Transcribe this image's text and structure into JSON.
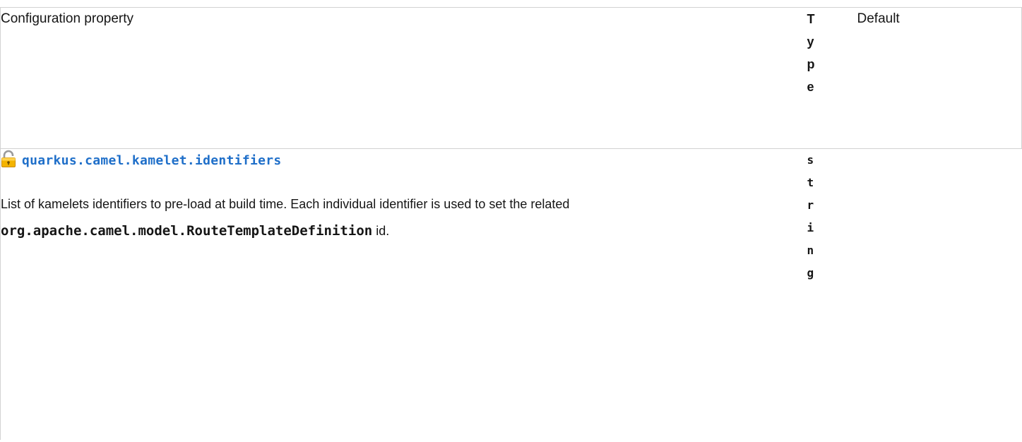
{
  "table": {
    "headers": {
      "property": "Configuration property",
      "type": "Type",
      "default": "Default"
    },
    "rows": [
      {
        "property": "quarkus.camel.kamelet.identifiers",
        "lock_icon": "lock-icon",
        "description_before": "List of kamelets identifiers to pre-load at build time. Each individual identifier is used to set the related ",
        "description_code": "org.apache.camel.model.RouteTemplateDefinition",
        "description_after": " id.",
        "type": "string",
        "default": ""
      }
    ]
  },
  "colors": {
    "link": "#1f6fc9",
    "border": "#d2d2d2",
    "text": "#151515"
  }
}
